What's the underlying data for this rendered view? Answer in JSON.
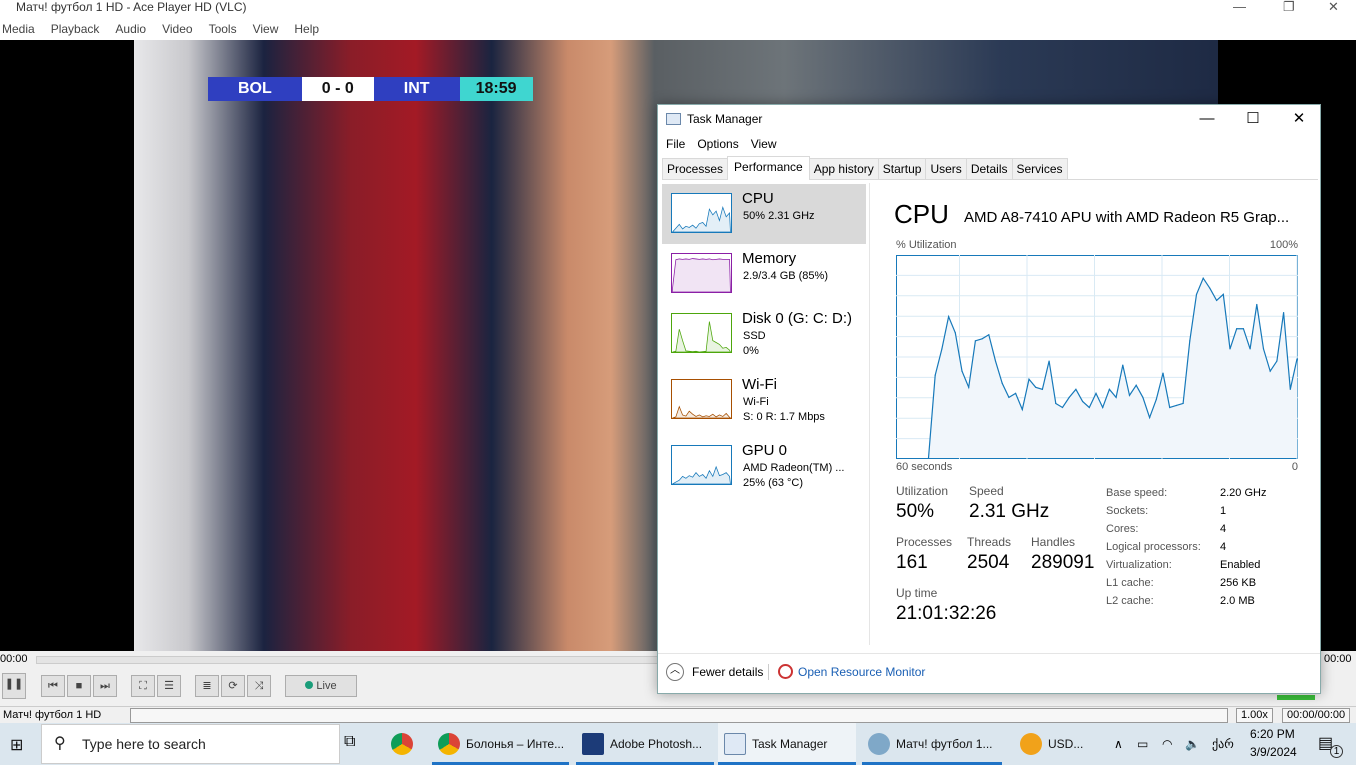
{
  "vlc": {
    "title": "Матч! футбол 1 HD - Ace Player HD (VLC)",
    "menu": [
      "Media",
      "Playback",
      "Audio",
      "Video",
      "Tools",
      "View",
      "Help"
    ],
    "score": {
      "home": "BOL",
      "score": "0 - 0",
      "away": "INT",
      "clock": "18:59"
    },
    "elapsed": "00:00",
    "remaining": "00:00",
    "live_label": "Live",
    "status_title": "Матч! футбол 1 HD",
    "speed": "1.00x",
    "time_total": "00:00/00:00",
    "volume": 0.8
  },
  "tm": {
    "title": "Task Manager",
    "menu": [
      "File",
      "Options",
      "View"
    ],
    "tabs": [
      "Processes",
      "Performance",
      "App history",
      "Startup",
      "Users",
      "Details",
      "Services"
    ],
    "active_tab": "Performance",
    "sidebar": [
      {
        "name": "CPU",
        "l1": "50% 2.31 GHz",
        "l2": "",
        "color": "#1779ba"
      },
      {
        "name": "Memory",
        "l1": "2.9/3.4 GB (85%)",
        "l2": "",
        "color": "#8b1fa6"
      },
      {
        "name": "Disk 0 (G: C: D:)",
        "l1": "SSD",
        "l2": "0%",
        "color": "#4da60c"
      },
      {
        "name": "Wi-Fi",
        "l1": "Wi-Fi",
        "l2": "S: 0 R: 1.7 Mbps",
        "color": "#a74f01"
      },
      {
        "name": "GPU 0",
        "l1": "AMD Radeon(TM) ...",
        "l2": "25% (63 °C)",
        "color": "#1779ba"
      }
    ],
    "cpu": {
      "heading": "CPU",
      "model": "AMD A8-7410 APU with AMD Radeon R5 Grap...",
      "ylabel": "% Utilization",
      "ymax_label": "100%",
      "xlabel": "60 seconds",
      "xmin_label": "0",
      "utilization_label": "Utilization",
      "utilization": "50%",
      "speed_label": "Speed",
      "speed": "2.31 GHz",
      "processes_label": "Processes",
      "processes": "161",
      "threads_label": "Threads",
      "threads": "2504",
      "handles_label": "Handles",
      "handles": "289091",
      "uptime_label": "Up time",
      "uptime": "21:01:32:26",
      "specs": [
        [
          "Base speed:",
          "2.20 GHz"
        ],
        [
          "Sockets:",
          "1"
        ],
        [
          "Cores:",
          "4"
        ],
        [
          "Logical processors:",
          "4"
        ],
        [
          "Virtualization:",
          "Enabled"
        ],
        [
          "L1 cache:",
          "256 KB"
        ],
        [
          "L2 cache:",
          "2.0 MB"
        ]
      ]
    },
    "fewer": "Fewer details",
    "resmon": "Open Resource Monitor"
  },
  "chart_data": {
    "type": "area",
    "title": "CPU % Utilization",
    "xlabel": "60 seconds",
    "ylim": [
      0,
      100
    ],
    "values": [
      0,
      41,
      54,
      70,
      62,
      43,
      35,
      58,
      59,
      61,
      48,
      37,
      30,
      32,
      24,
      39,
      35,
      34,
      48,
      27,
      25,
      30,
      34,
      28,
      25,
      32,
      25,
      34,
      30,
      46,
      31,
      36,
      30,
      20,
      29,
      42,
      25,
      26,
      27,
      58,
      81,
      89,
      84,
      78,
      81,
      54,
      64,
      64,
      54,
      76,
      54,
      43,
      48,
      72,
      34,
      49
    ]
  },
  "taskbar": {
    "search_placeholder": "Type here to search",
    "items": [
      "Болонья – Инте...",
      "Adobe Photosh...",
      "Task Manager",
      "Матч! футбол 1...",
      "USD..."
    ],
    "lang": "ქარ",
    "time": "6:20 PM",
    "date": "3/9/2024",
    "notifications": "1"
  }
}
